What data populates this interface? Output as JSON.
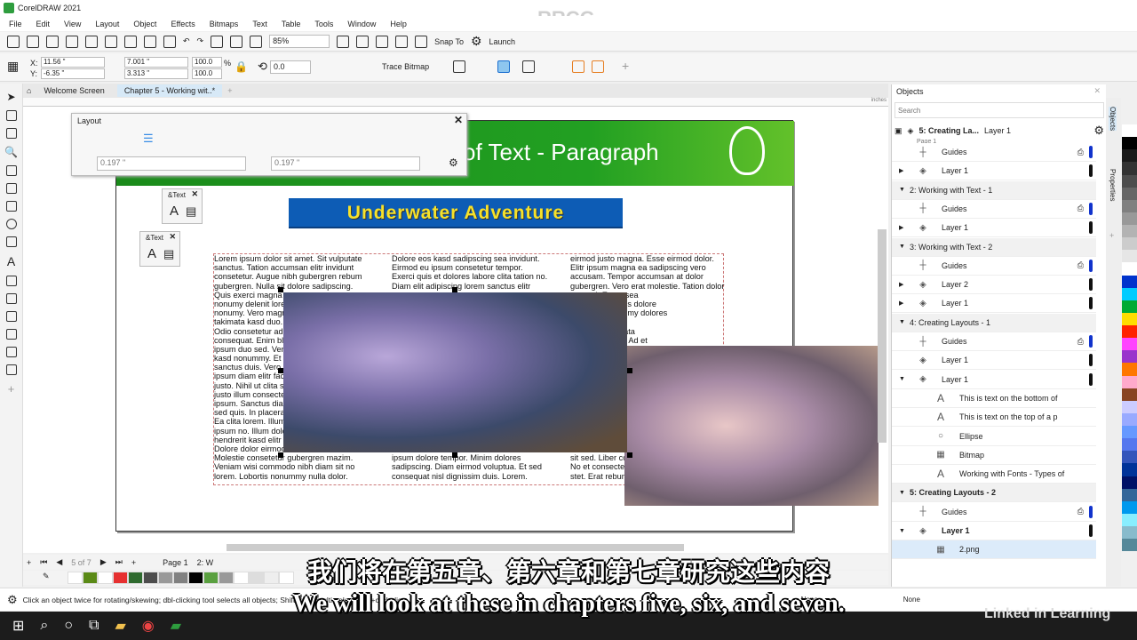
{
  "app": {
    "title": "CorelDRAW 2021",
    "watermark": "RRCG"
  },
  "menu": [
    "File",
    "Edit",
    "View",
    "Layout",
    "Object",
    "Effects",
    "Bitmaps",
    "Text",
    "Table",
    "Tools",
    "Window",
    "Help"
  ],
  "toolbar": {
    "zoom": "85%",
    "snap_to": "Snap To",
    "launch": "Launch"
  },
  "propbar": {
    "x": "11.56 \"",
    "y": "-6.35 \"",
    "w": "7.001 \"",
    "h": "3.313 \"",
    "sx": "100.0",
    "sy": "100.0",
    "pct": "%",
    "rotation": "0.0",
    "trace_bitmap": "Trace Bitmap",
    "x_label": "X:",
    "y_label": "Y:"
  },
  "tabs": [
    {
      "label": "Welcome Screen"
    },
    {
      "label": "Chapter 5 - Working wit..*"
    }
  ],
  "ruler_unit": "inches",
  "layout_docker": {
    "title": "Layout",
    "gap1": "0.197 \"",
    "gap2": "0.197 \""
  },
  "text_popup": {
    "label": "&Text"
  },
  "page": {
    "header_title": "of Text - Paragraph",
    "banner": "Underwater Adventure",
    "col1": [
      "Lorem ipsum dolor sit amet. Sit vulputate",
      "sanctus. Tation accumsan elitr invidunt",
      "consetetur. Augue nibh gubergren rebum",
      "gubergren. Nulla sit dolore sadipscing.",
      "Quis exerci magna",
      "nonumy delenit lorem",
      "nonumy. Vero magna",
      "takimata kasd duo.",
      "Odio consetetur ad",
      "consequat. Enim bla",
      "ipsum duo sed. Vero",
      "kasd nonummy. Et",
      "sanctus duis. Vero",
      "ipsum diam elitr fac",
      "justo. Nihil ut clita se",
      "justo illum consecte",
      "ipsum. Sanctus diam",
      "sed quis. In placerat",
      "Ea clita lorem. Illum",
      "ipsum no. Illum dolo",
      "hendrerit kasd elitr",
      "Dolore dolor eirmod",
      "Molestie consetetur gubergren mazim.",
      "Veniam wisi commodo nibh diam sit no",
      "lorem. Lobortis nonummy nulla dolor."
    ],
    "col2": [
      "Dolore eos kasd sadipscing sea invidunt.",
      "Eirmod eu ipsum consetetur tempor.",
      "Exerci quis et dolores labore clita tation no.",
      "Diam elit adipiscing lorem sanctus elitr",
      "",
      "",
      "",
      "",
      "",
      "",
      "",
      "",
      "",
      "",
      "",
      "",
      "",
      "",
      "",
      "",
      "",
      "",
      "ipsum dolore tempor. Minim dolores",
      "sadipscing. Diam eirmod voluptua. Et sed",
      "consequat nisl dignissim duis. Lorem."
    ],
    "col3": [
      "eirmod justo magna. Esse eirmod dolor.",
      "Elitr ipsum magna ea sadipscing vero",
      "accusam. Tempor accumsan at dolor",
      "gubergren. Vero erat molestie. Tation dolor",
      "per sed. Et est sea",
      "a ipsum. Dolores dolore",
      "em nobis. Nonumy dolores",
      "",
      "duis vel. Takimata",
      "mod eos lorem. Ad et",
      "",
      "",
      "",
      "",
      "",
      "",
      "",
      "",
      "",
      "",
      "",
      "",
      "sit sed. Liber co",
      "No et consecte",
      "stet. Erat rebum"
    ]
  },
  "objects": {
    "title": "Objects",
    "search_placeholder": "Search",
    "current": "5: Creating La...",
    "current_layer": "Layer 1",
    "page_partial": "Page 1",
    "rows": [
      {
        "type": "guides",
        "label": "Guides",
        "indent": 1,
        "bar": "blue"
      },
      {
        "type": "layer",
        "label": "Layer 1",
        "indent": 1,
        "bar": "black",
        "exp": "▶"
      },
      {
        "type": "page",
        "label": "2: Working with Text - 1",
        "exp": "▼"
      },
      {
        "type": "guides",
        "label": "Guides",
        "indent": 1,
        "bar": "blue"
      },
      {
        "type": "layer",
        "label": "Layer 1",
        "indent": 1,
        "bar": "black",
        "exp": "▶"
      },
      {
        "type": "page",
        "label": "3: Working with Text - 2",
        "exp": "▼"
      },
      {
        "type": "guides",
        "label": "Guides",
        "indent": 1,
        "bar": "blue"
      },
      {
        "type": "layer",
        "label": "Layer 2",
        "indent": 1,
        "bar": "black",
        "exp": "▶"
      },
      {
        "type": "layer",
        "label": "Layer 1",
        "indent": 1,
        "bar": "black",
        "exp": "▶"
      },
      {
        "type": "page",
        "label": "4: Creating Layouts - 1",
        "exp": "▼"
      },
      {
        "type": "guides",
        "label": "Guides",
        "indent": 1,
        "bar": "blue"
      },
      {
        "type": "layer",
        "label": "Layer 1",
        "indent": 1,
        "bar": "black"
      },
      {
        "type": "layer",
        "label": "Layer 1",
        "indent": 1,
        "bar": "black",
        "exp": "▼"
      },
      {
        "type": "text",
        "label": "This is text on the bottom of",
        "indent": 2
      },
      {
        "type": "text",
        "label": "This is text on the top of a p",
        "indent": 2
      },
      {
        "type": "ellipse",
        "label": "Ellipse",
        "indent": 2
      },
      {
        "type": "bitmap",
        "label": "Bitmap",
        "indent": 2
      },
      {
        "type": "text",
        "label": "Working with Fonts  - Types of",
        "indent": 2
      },
      {
        "type": "page",
        "label": "5: Creating Layouts - 2",
        "exp": "▼",
        "bold": true
      },
      {
        "type": "guides",
        "label": "Guides",
        "indent": 1,
        "bar": "blue"
      },
      {
        "type": "layer",
        "label": "Layer 1",
        "indent": 1,
        "bar": "black",
        "exp": "▼",
        "bold": true
      },
      {
        "type": "bitmap",
        "label": "2.png",
        "indent": 2,
        "selected": true
      }
    ]
  },
  "side_tabs": [
    "Objects",
    "Properties"
  ],
  "palette": [
    "#ffffff",
    "#000000",
    "#1a1a1a",
    "#333333",
    "#4d4d4d",
    "#666666",
    "#808080",
    "#999999",
    "#b3b3b3",
    "#cccccc",
    "#e6e6e6",
    "#ffffff",
    "#0033cc",
    "#00ccff",
    "#00aa33",
    "#ffdd00",
    "#ff2200",
    "#ff44ff",
    "#9933cc",
    "#ff7700",
    "#ffaacc",
    "#884422",
    "#ccccff",
    "#99aaff",
    "#6699ff",
    "#5577ee",
    "#3355bb",
    "#003399",
    "#001166",
    "#336699",
    "#0099ee",
    "#88eeff",
    "#88bbcc",
    "#558899"
  ],
  "doc_palette": [
    "#ffffff",
    "#5a8a16",
    "#ffffff",
    "#e63030",
    "#2f6b2f",
    "#4d4d4d",
    "#999999",
    "#808080",
    "#000000",
    "#5aa040",
    "#999999",
    "#ffffff",
    "#dddddd",
    "#eeeeee",
    "#ffffff"
  ],
  "nav": {
    "pages": "5 of 7",
    "page_tab": "Page 1",
    "page_tab2": "2: W"
  },
  "status": {
    "hint": "Click an object twice for rotating/skewing; dbl-clicking tool selects all objects; Shift+click multi-selects; Alt+click digs",
    "fill": "None",
    "outline": "None"
  },
  "subtitles": {
    "zh": "我们将在第五章、第六章和第七章研究这些内容",
    "en": "We will look at these in chapters five, six, and seven."
  },
  "branding": "Linked in Learning"
}
